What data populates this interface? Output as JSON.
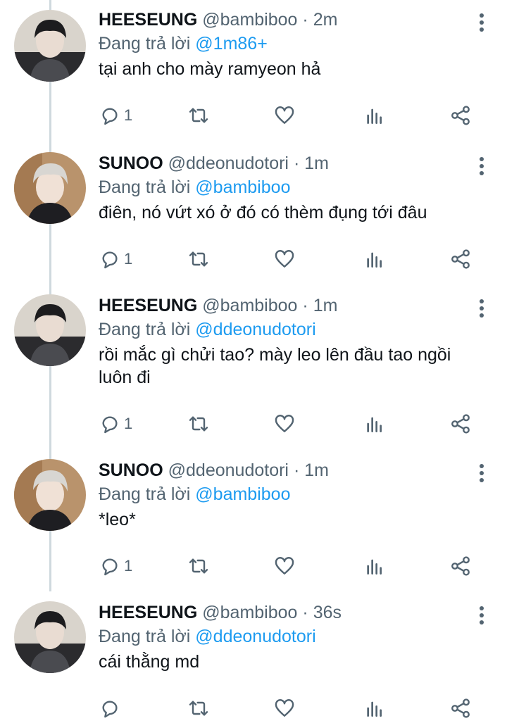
{
  "colors": {
    "accent": "#1d9bf0",
    "muted": "#536471",
    "text": "#0f1419"
  },
  "reply_prefix": "Đang trả lời",
  "tweets": [
    {
      "name": "HEESEUNG",
      "handle": "@bambiboo",
      "dot": "·",
      "time": "2m",
      "reply_to": "@1m86+",
      "text": "tại anh cho mày ramyeon hả",
      "reply_count": "1"
    },
    {
      "name": "SUNOO",
      "handle": "@ddeonudotori",
      "dot": "·",
      "time": "1m",
      "reply_to": "@bambiboo",
      "text": "điên, nó vứt xó ở đó có thèm đụng tới đâu",
      "reply_count": "1"
    },
    {
      "name": "HEESEUNG",
      "handle": "@bambiboo",
      "dot": "·",
      "time": "1m",
      "reply_to": "@ddeonudotori",
      "text": "rồi mắc gì chửi tao? mày leo lên đầu tao ngồi luôn đi",
      "reply_count": "1"
    },
    {
      "name": "SUNOO",
      "handle": "@ddeonudotori",
      "dot": "·",
      "time": "1m",
      "reply_to": "@bambiboo",
      "text": "*leo*",
      "reply_count": "1"
    },
    {
      "name": "HEESEUNG",
      "handle": "@bambiboo",
      "dot": "·",
      "time": "36s",
      "reply_to": "@ddeonudotori",
      "text": "cái thằng md",
      "reply_count": ""
    }
  ]
}
